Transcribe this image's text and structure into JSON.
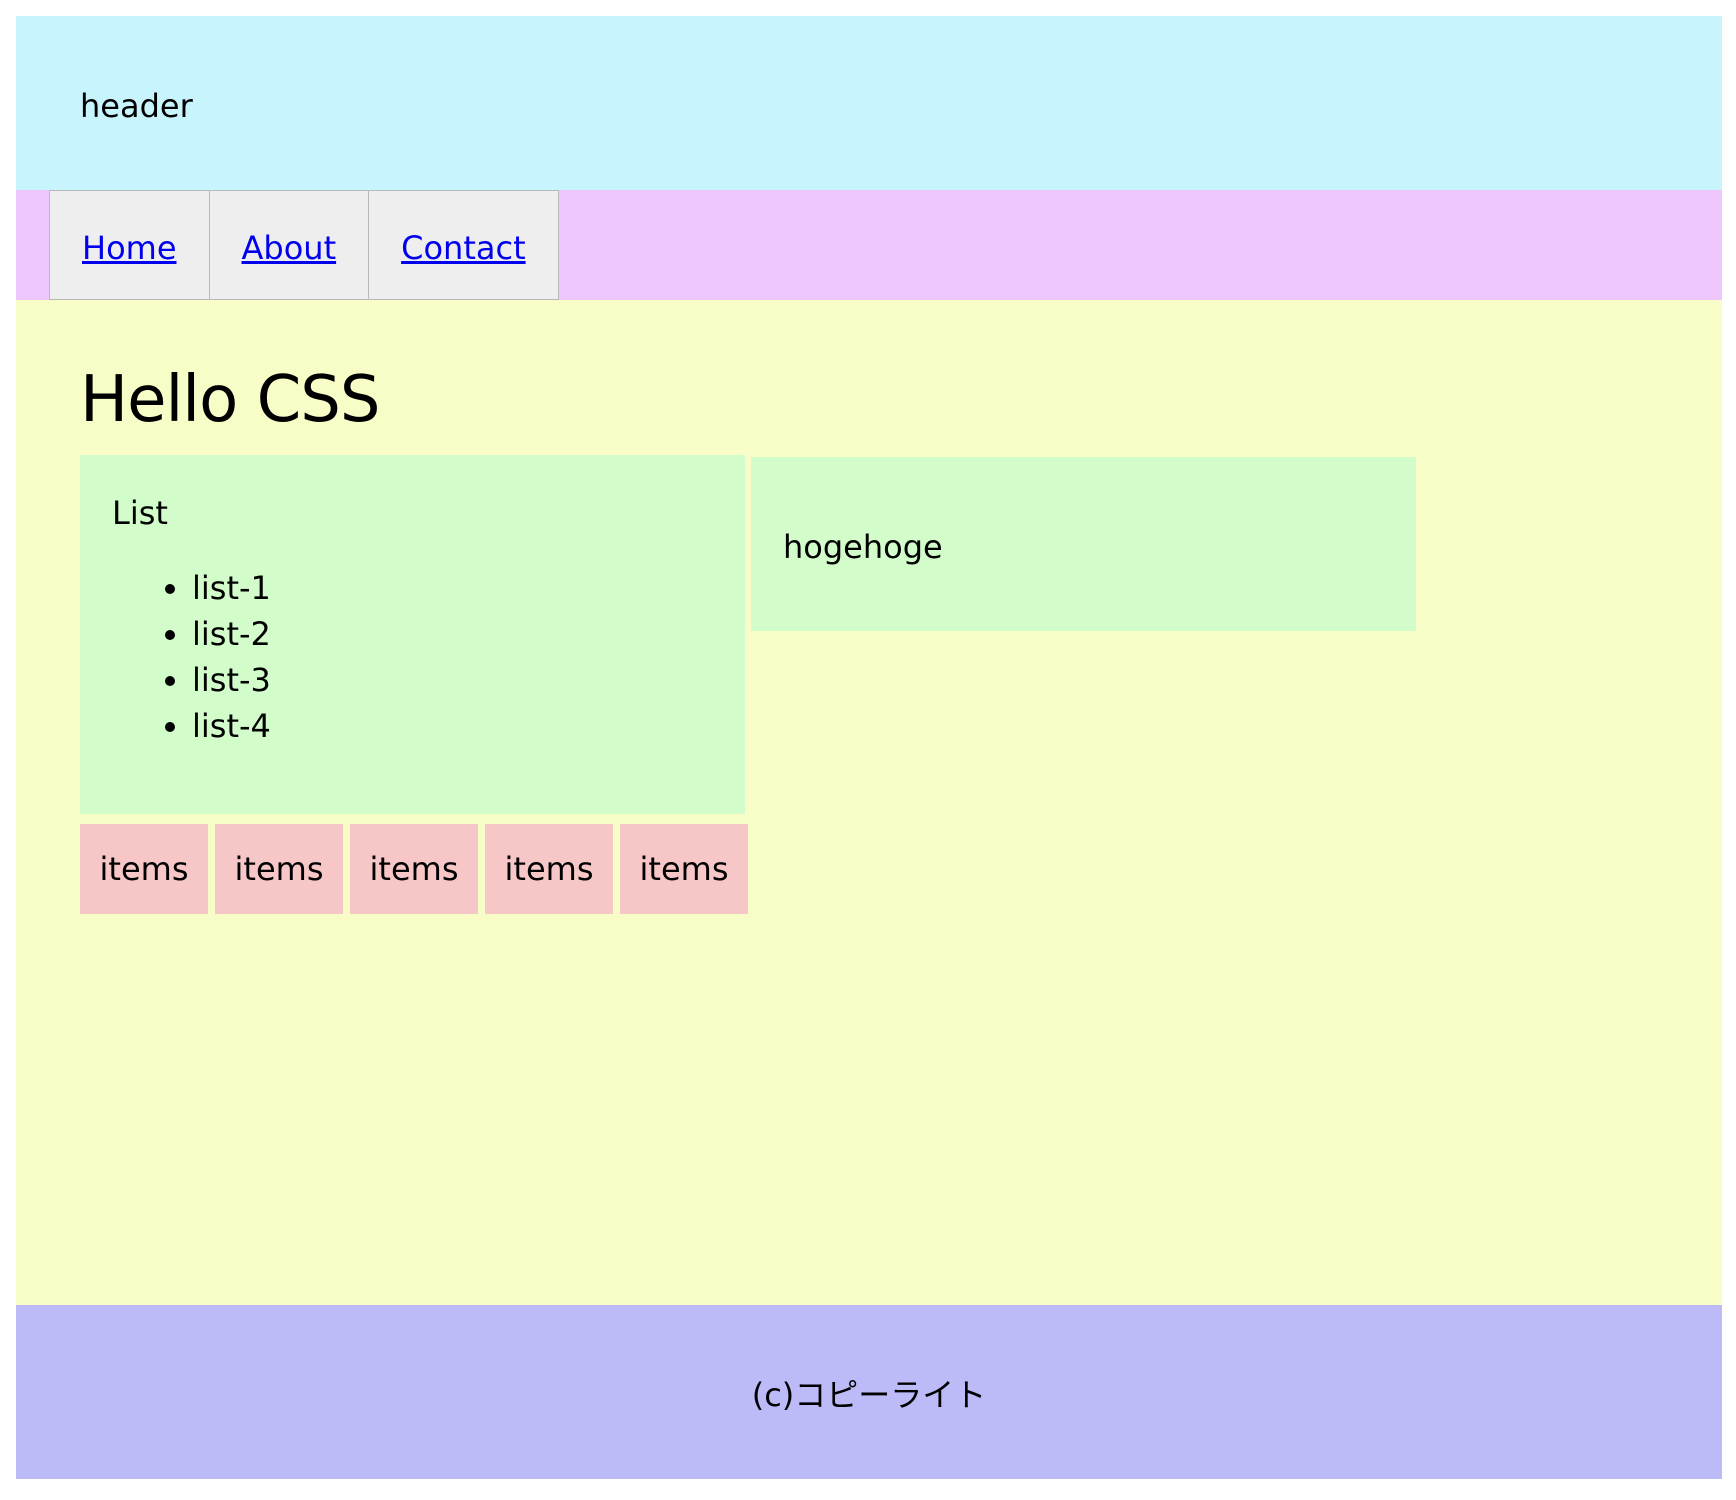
{
  "header": {
    "title": "header"
  },
  "nav": {
    "items": [
      {
        "label": "Home"
      },
      {
        "label": "About"
      },
      {
        "label": "Contact"
      }
    ]
  },
  "main": {
    "title": "Hello CSS",
    "list_box": {
      "title": "List",
      "items": [
        "list-1",
        "list-2",
        "list-3",
        "list-4"
      ]
    },
    "side_box": {
      "text": "hogehoge"
    },
    "item_tiles": [
      "items",
      "items",
      "items",
      "items",
      "items"
    ]
  },
  "footer": {
    "copyright": "(c)コピーライト"
  },
  "colors": {
    "header_bg": "#c8f4fd",
    "nav_bg": "#eec8fd",
    "nav_item_bg": "#eeeeee",
    "link": "#0000ee",
    "main_bg": "#f8fdc8",
    "box_bg": "#d2fdca",
    "item_bg": "#f7c7c7",
    "footer_bg": "#bcbbf8"
  }
}
